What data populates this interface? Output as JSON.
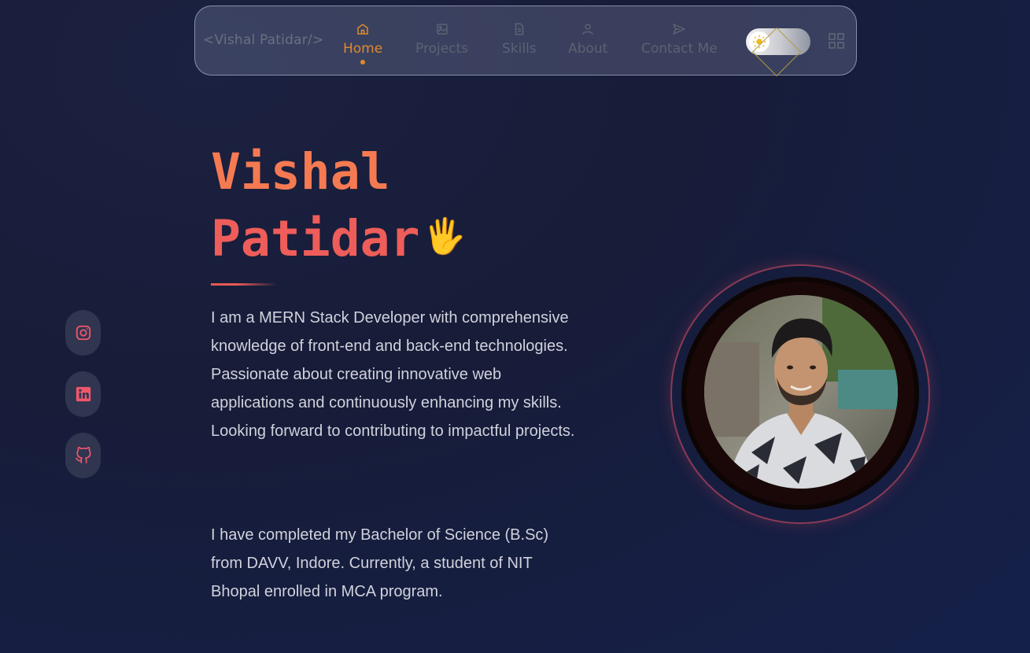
{
  "nav": {
    "brand": "<Vishal Patidar/>",
    "items": [
      {
        "label": "Home",
        "icon": "home-icon",
        "active": true
      },
      {
        "label": "Projects",
        "icon": "image-icon",
        "active": false
      },
      {
        "label": "Skills",
        "icon": "document-icon",
        "active": false
      },
      {
        "label": "About",
        "icon": "user-icon",
        "active": false
      },
      {
        "label": "Contact Me",
        "icon": "send-icon",
        "active": false
      }
    ],
    "theme_toggle_icon": "sun-icon",
    "menu_icon": "grid-icon"
  },
  "social": [
    {
      "icon": "instagram-icon"
    },
    {
      "icon": "linkedin-icon"
    },
    {
      "icon": "github-icon"
    }
  ],
  "hero": {
    "name_line1": "Vishal",
    "name_line2": "Patidar",
    "wave": "🖐",
    "intro": "I am a MERN Stack Developer with comprehensive knowledge of front-end and back-end technologies. Passionate about creating innovative web applications and continuously enhancing my skills. Looking forward to contributing to impactful projects.",
    "education": "I have completed my Bachelor of Science (B.Sc) from DAVV, Indore. Currently, a student of NIT Bhopal enrolled in MCA program."
  },
  "colors": {
    "accent": "#e0892e",
    "name_gradient_start": "#f57a52",
    "name_gradient_end": "#ee5d59",
    "social_icon": "#f0566a"
  }
}
